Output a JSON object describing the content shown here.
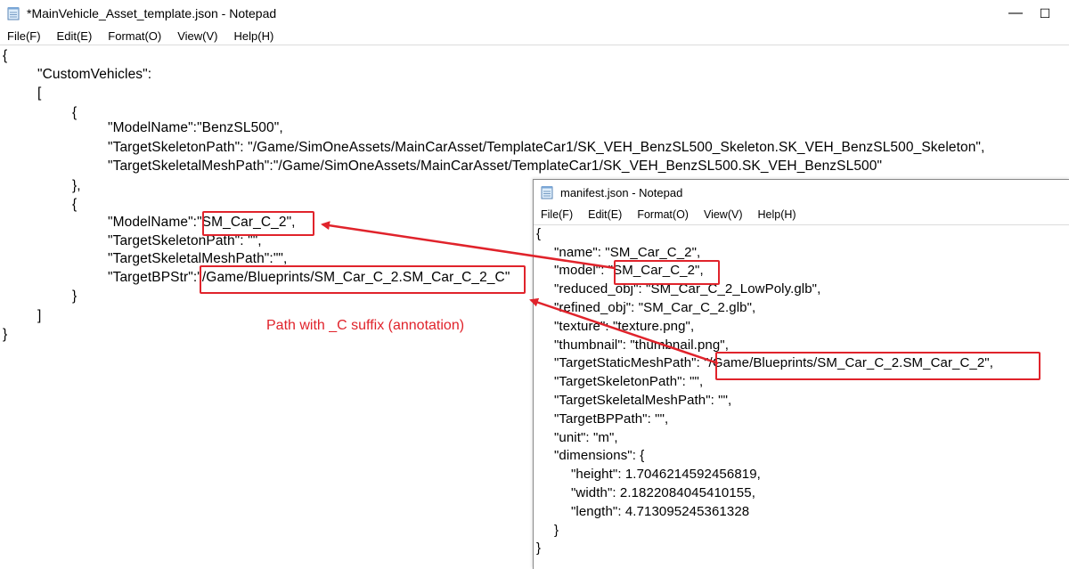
{
  "window_main": {
    "title": "*MainVehicle_Asset_template.json - Notepad",
    "controls": {
      "minimize": "—",
      "maximize": "☐"
    },
    "menu": [
      "File(F)",
      "Edit(E)",
      "Format(O)",
      "View(V)",
      "Help(H)"
    ],
    "lines": [
      "{",
      "\"CustomVehicles\":",
      "[",
      "{",
      "\"ModelName\":\"BenzSL500\",",
      "\"TargetSkeletonPath\": \"/Game/SimOneAssets/MainCarAsset/TemplateCar1/SK_VEH_BenzSL500_Skeleton.SK_VEH_BenzSL500_Skeleton\",",
      "\"TargetSkeletalMeshPath\":\"/Game/SimOneAssets/MainCarAsset/TemplateCar1/SK_VEH_BenzSL500.SK_VEH_BenzSL500\"",
      "},",
      "{",
      "\"ModelName\":\"SM_Car_C_2\",",
      "\"TargetSkeletonPath\": \"\",",
      "\"TargetSkeletalMeshPath\":\"\",",
      "\"TargetBPStr\":\"/Game/Blueprints/SM_Car_C_2.SM_Car_C_2_C\"",
      "}",
      "]",
      "}"
    ]
  },
  "window_manifest": {
    "title": "manifest.json - Notepad",
    "menu": [
      "File(F)",
      "Edit(E)",
      "Format(O)",
      "View(V)",
      "Help(H)"
    ],
    "lines": [
      "{",
      "\"name\": \"SM_Car_C_2\",",
      "\"model\": \"SM_Car_C_2\",",
      "\"reduced_obj\": \"SM_Car_C_2_LowPoly.glb\",",
      "\"refined_obj\": \"SM_Car_C_2.glb\",",
      "\"texture\": \"texture.png\",",
      "\"thumbnail\": \"thumbnail.png\",",
      "\"TargetStaticMeshPath\": \"/Game/Blueprints/SM_Car_C_2.SM_Car_C_2\",",
      "\"TargetSkeletonPath\": \"\",",
      "\"TargetSkeletalMeshPath\": \"\",",
      "\"TargetBPPath\": \"\",",
      "\"unit\": \"m\",",
      "\"dimensions\": {",
      "\"height\": 1.7046214592456819,",
      "\"width\": 2.1822084045410155,",
      "\"length\": 4.713095245361328",
      "}",
      "}"
    ]
  },
  "annotation": {
    "text": "Path with _C suffix (annotation)"
  },
  "colors": {
    "highlight": "#e0232b",
    "text": "#000000",
    "background": "#ffffff"
  },
  "icons": {
    "app": "notepad-icon"
  }
}
